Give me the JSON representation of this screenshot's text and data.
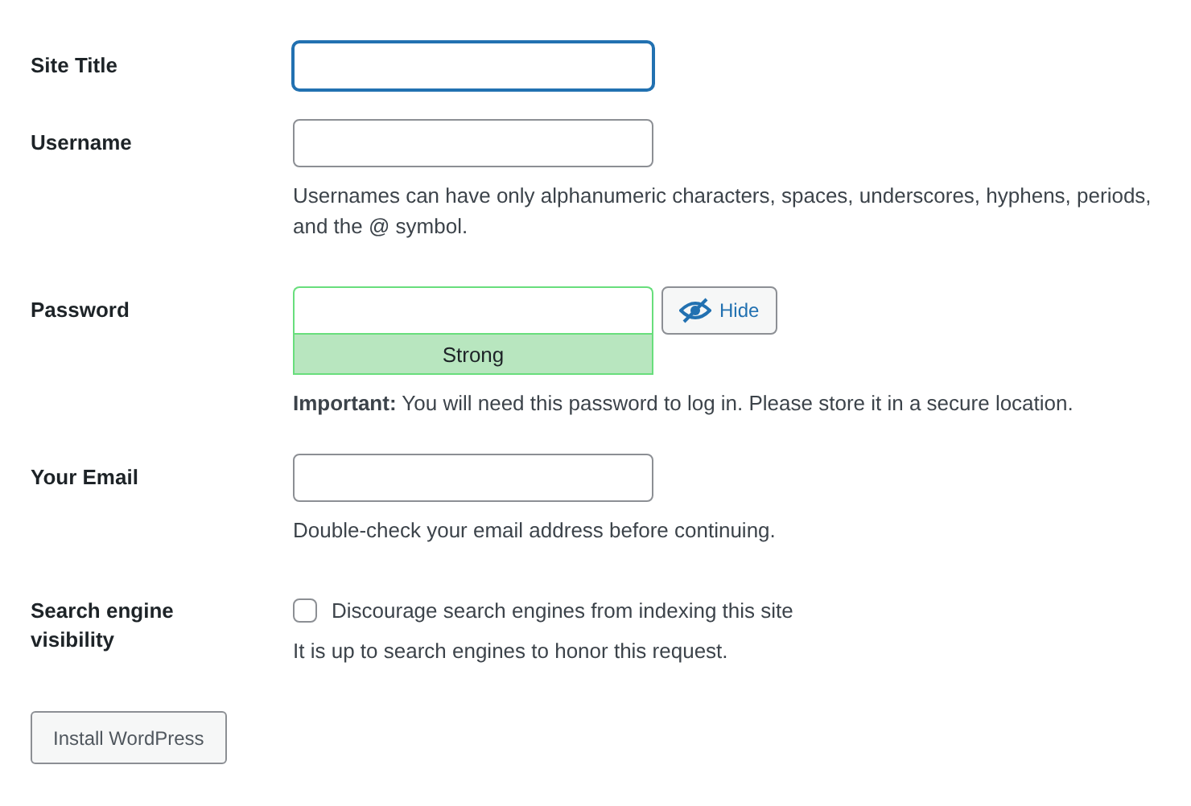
{
  "rows": [
    {
      "kind": "text",
      "label": "Site Title",
      "focused": true
    },
    {
      "kind": "text",
      "label": "Username",
      "help": "Usernames can have only alphanumeric characters, spaces, underscores, hyphens, periods, and the @ symbol."
    },
    {
      "kind": "password",
      "label": "Password",
      "toggle": "Hide",
      "strength_label": "Strong",
      "help": "**Important:** You will need this password to log in. Please store it in a secure location."
    },
    {
      "kind": "text",
      "label": "Your Email",
      "help": "Double-check your email address before continuing."
    },
    {
      "kind": "checkbox",
      "label": "Search engine visibility",
      "checked": false,
      "option": "Discourage search engines from indexing this site",
      "help": "It is up to search engines to honor this request."
    }
  ],
  "submit": "Install WordPress"
}
